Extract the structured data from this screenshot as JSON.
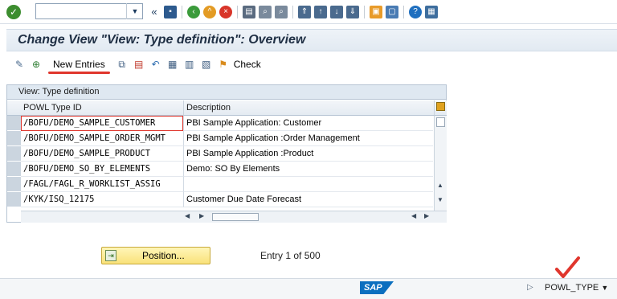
{
  "title": "Change View \"View: Type definition\": Overview",
  "toolbar": {
    "command_value": ""
  },
  "app_toolbar": {
    "new_entries": "New Entries",
    "check": "Check"
  },
  "table": {
    "caption": "View: Type definition",
    "columns": [
      "POWL Type ID",
      "Description"
    ],
    "rows": [
      {
        "id": "/BOFU/DEMO_SAMPLE_CUSTOMER",
        "desc": "PBI Sample Application: Customer"
      },
      {
        "id": "/BOFU/DEMO_SAMPLE_ORDER_MGMT",
        "desc": "PBI Sample Application :Order Management"
      },
      {
        "id": "/BOFU/DEMO_SAMPLE_PRODUCT",
        "desc": "PBI Sample Application :Product"
      },
      {
        "id": "/BOFU/DEMO_SO_BY_ELEMENTS",
        "desc": "Demo: SO By Elements"
      },
      {
        "id": "/FAGL/FAGL_R_WORKLIST_ASSIG",
        "desc": ""
      },
      {
        "id": "/KYK/ISQ_12175",
        "desc": "Customer Due Date Forecast"
      }
    ]
  },
  "position_button": "Position...",
  "entry_info": "Entry 1 of 500",
  "status": {
    "logo": "SAP",
    "transaction": "POWL_TYPE"
  },
  "colors": {
    "accent": "#0b6fbf",
    "title_bg": "#e6edf4",
    "annotation": "#e0362d"
  }
}
